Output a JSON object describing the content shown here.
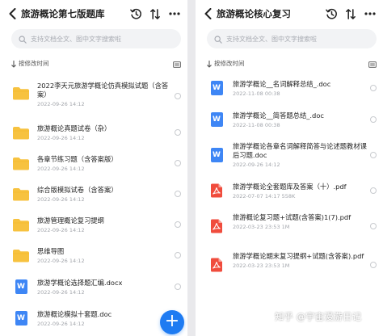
{
  "left": {
    "title": "旅游概论第七版题库",
    "search_placeholder": "支持文档全文、图中文字搜索啦",
    "sort_label": "按修改时间",
    "items": [
      {
        "type": "folder",
        "name": "2022李天元旅游学概论仿真模拟试题（含答案）",
        "meta": "2022-09-26 14:12"
      },
      {
        "type": "folder",
        "name": "旅游概论真题试卷（杂）",
        "meta": "2022-09-26 14:12"
      },
      {
        "type": "folder",
        "name": "各章节练习题（含答案版）",
        "meta": "2022-09-26 14:12"
      },
      {
        "type": "folder",
        "name": "综合版模拟试卷（含答案）",
        "meta": "2022-09-26 14:12"
      },
      {
        "type": "folder",
        "name": "旅游管理概论复习提纲",
        "meta": "2022-09-26 14:12"
      },
      {
        "type": "folder",
        "name": "思维导图",
        "meta": "2022-09-26 14:12"
      },
      {
        "type": "word",
        "name": "旅游学概论选择题汇编.docx",
        "meta": "2022-09-26 14:12"
      },
      {
        "type": "word",
        "name": "旅游概论模拟十套题.doc",
        "meta": "2022-09-26 14:12"
      }
    ]
  },
  "right": {
    "title": "旅游概论核心复习",
    "search_placeholder": "支持文档全文、图中文字搜索啦",
    "sort_label": "按修改时间",
    "items": [
      {
        "type": "word",
        "name": "旅游学概论__名词解释总结_.doc",
        "meta": "2022-11-08 00:38"
      },
      {
        "type": "word",
        "name": "旅游学概论__简答题总结_.doc",
        "meta": "2022-11-08 00:38"
      },
      {
        "type": "word",
        "name": "旅游学概论各章名词解释简答与论述题教材课后习题.doc",
        "meta": "2022-09-26 14:12"
      },
      {
        "type": "pdf",
        "name": "旅游学概论全套题库及答案（十）.pdf",
        "meta": "2022-07-07 14:17   558K"
      },
      {
        "type": "pdf",
        "name": "旅游概论复习题+试题(含答案)1(7).pdf",
        "meta": "2022-03-23 23:53   1M"
      },
      {
        "type": "pdf",
        "name": "旅游学概论期末复习提纲+试题(含答案).pdf",
        "meta": "2022-03-23 23:53   1M"
      }
    ]
  },
  "fab_label": "+",
  "watermark": "知乎 @宇宙漫游日记",
  "colors": {
    "accent": "#1e7bf2",
    "folder": "#f7c23f",
    "word": "#3e86f5",
    "pdf": "#f04c3d"
  }
}
